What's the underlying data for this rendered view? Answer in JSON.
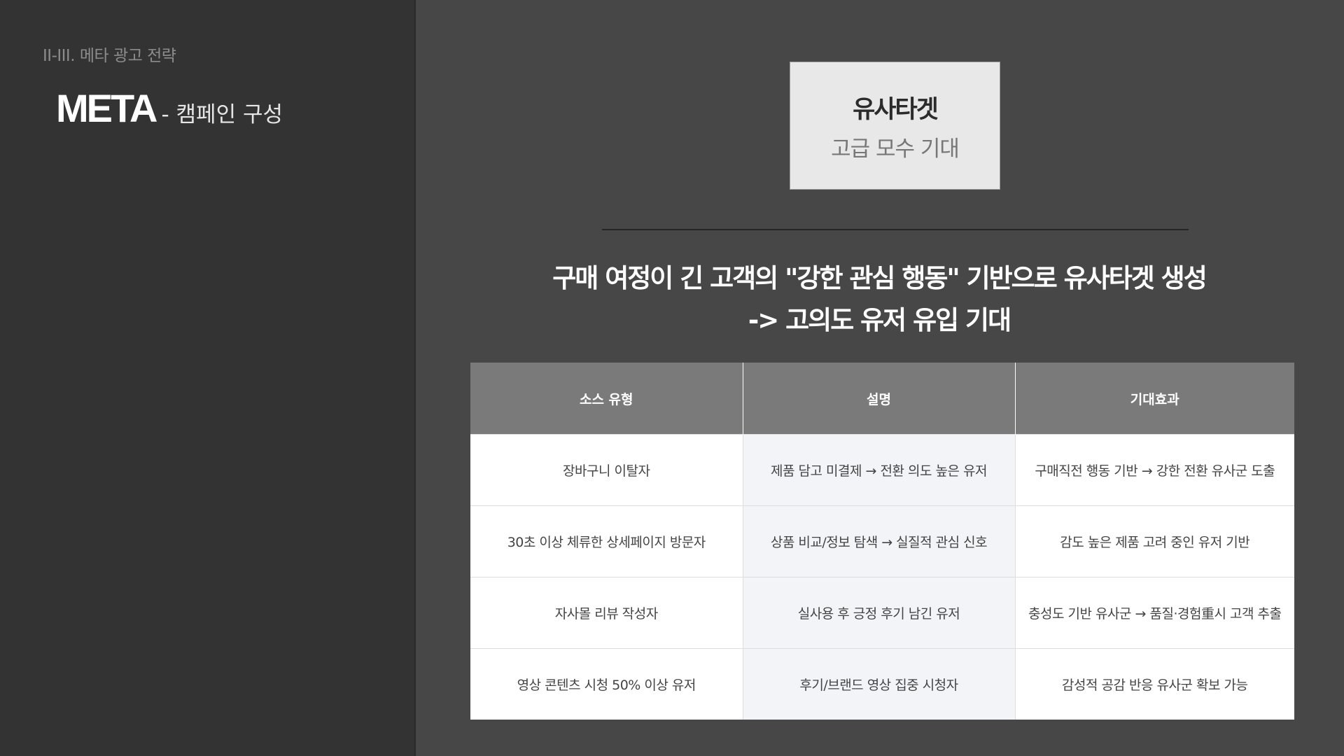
{
  "section_label": "II-III. 메타 광고 전략",
  "title": {
    "brand": "META",
    "subtitle": "- 캠페인 구성"
  },
  "target_box": {
    "title": "유사타겟",
    "subtitle": "고급 모수 기대"
  },
  "headline": {
    "line1": "구매 여정이 긴 고객의 \"강한 관심 행동\" 기반으로 유사타겟 생성",
    "line2": "-> 고의도 유저 유입 기대"
  },
  "table": {
    "headers": [
      "소스 유형",
      "설명",
      "기대효과"
    ],
    "rows": [
      [
        "장바구니 이탈자",
        "제품 담고 미결제 → 전환 의도 높은 유저",
        "구매직전 행동 기반 → 강한 전환 유사군 도출"
      ],
      [
        "30초 이상 체류한 상세페이지 방문자",
        "상품 비교/정보 탐색 → 실질적 관심 신호",
        "감도 높은 제품 고려 중인 유저 기반"
      ],
      [
        "자사몰 리뷰 작성자",
        "실사용 후 긍정 후기 남긴 유저",
        "충성도 기반 유사군 → 품질·경험重시 고객 추출"
      ],
      [
        "영상 콘텐츠 시청 50% 이상 유저",
        "후기/브랜드 영상 집중 시청자",
        "감성적 공감 반응 유사군 확보 가능"
      ]
    ]
  }
}
